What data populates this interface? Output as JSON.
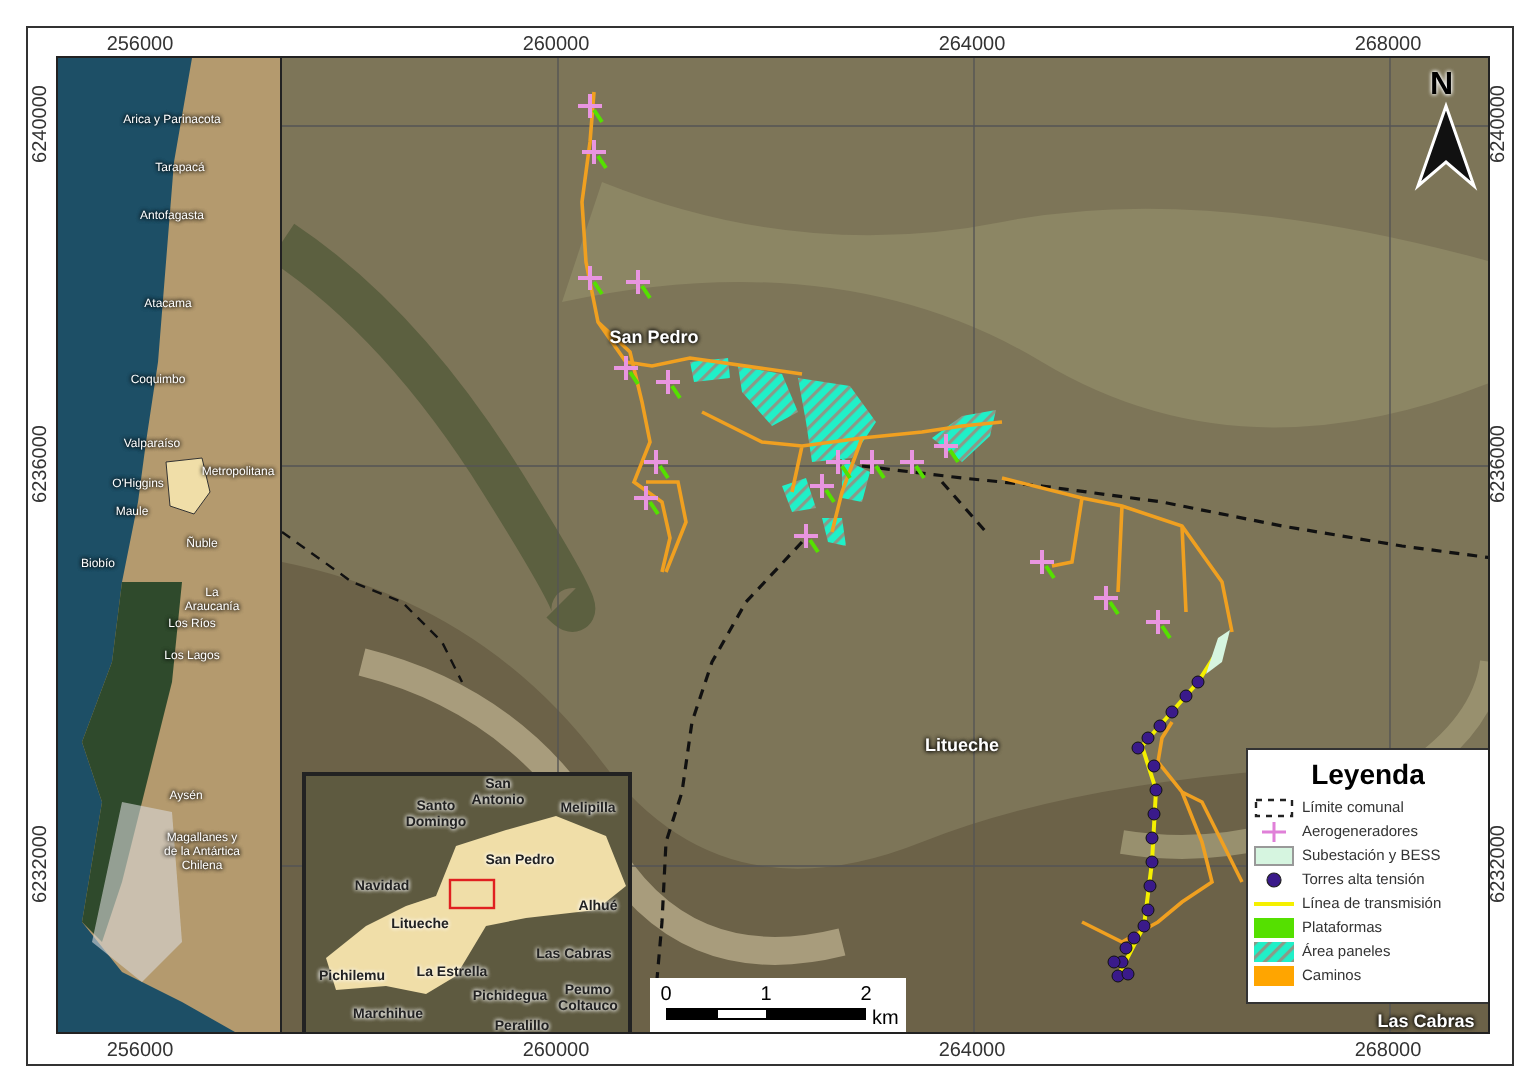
{
  "top_ticks": [
    "256000",
    "260000",
    "264000",
    "268000"
  ],
  "bottom_ticks": [
    "256000",
    "260000",
    "264000",
    "268000"
  ],
  "left_ticks": [
    "6240000",
    "6236000",
    "6232000"
  ],
  "right_ticks": [
    "6240000",
    "6236000",
    "6232000"
  ],
  "north_arrow": {
    "label": "N"
  },
  "place_labels": [
    {
      "text": "San Pedro"
    },
    {
      "text": "Litueche"
    },
    {
      "text": "Las Cabras"
    }
  ],
  "overview_map": {
    "labels": [
      "Arica y Parinacota",
      "Tarapacá",
      "Antofagasta",
      "Atacama",
      "Coquimbo",
      "Valparaíso",
      "Metropolitana",
      "O'Higgins",
      "Maule",
      "Ñuble",
      "Biobío",
      "La Araucanía",
      "Los Ríos",
      "Los Lagos",
      "Aysén",
      "Magallanes y de la Antártica Chilena"
    ]
  },
  "inset_map": {
    "labels": [
      "San Antonio",
      "Melipilla",
      "Santo Domingo",
      "San Pedro",
      "Navidad",
      "Alhué",
      "Litueche",
      "Las Cabras",
      "Pichilemu",
      "La Estrella",
      "Pichidegua",
      "Peumo Coltauco",
      "Marchihue",
      "Peralillo"
    ]
  },
  "scale_bar": {
    "ticks": [
      "0",
      "1",
      "2"
    ],
    "unit": "km"
  },
  "legend": {
    "title": "Leyenda",
    "items": [
      {
        "kind": "boundary",
        "label": "Límite comunal"
      },
      {
        "kind": "turbine",
        "label": "Aerogeneradores"
      },
      {
        "kind": "substation",
        "label": "Subestación y BESS"
      },
      {
        "kind": "tower",
        "label": "Torres alta tensión"
      },
      {
        "kind": "line",
        "label": "Línea de transmisión"
      },
      {
        "kind": "platform",
        "label": "Plataformas"
      },
      {
        "kind": "panels",
        "label": "Área paneles"
      },
      {
        "kind": "road",
        "label": "Caminos"
      }
    ]
  }
}
